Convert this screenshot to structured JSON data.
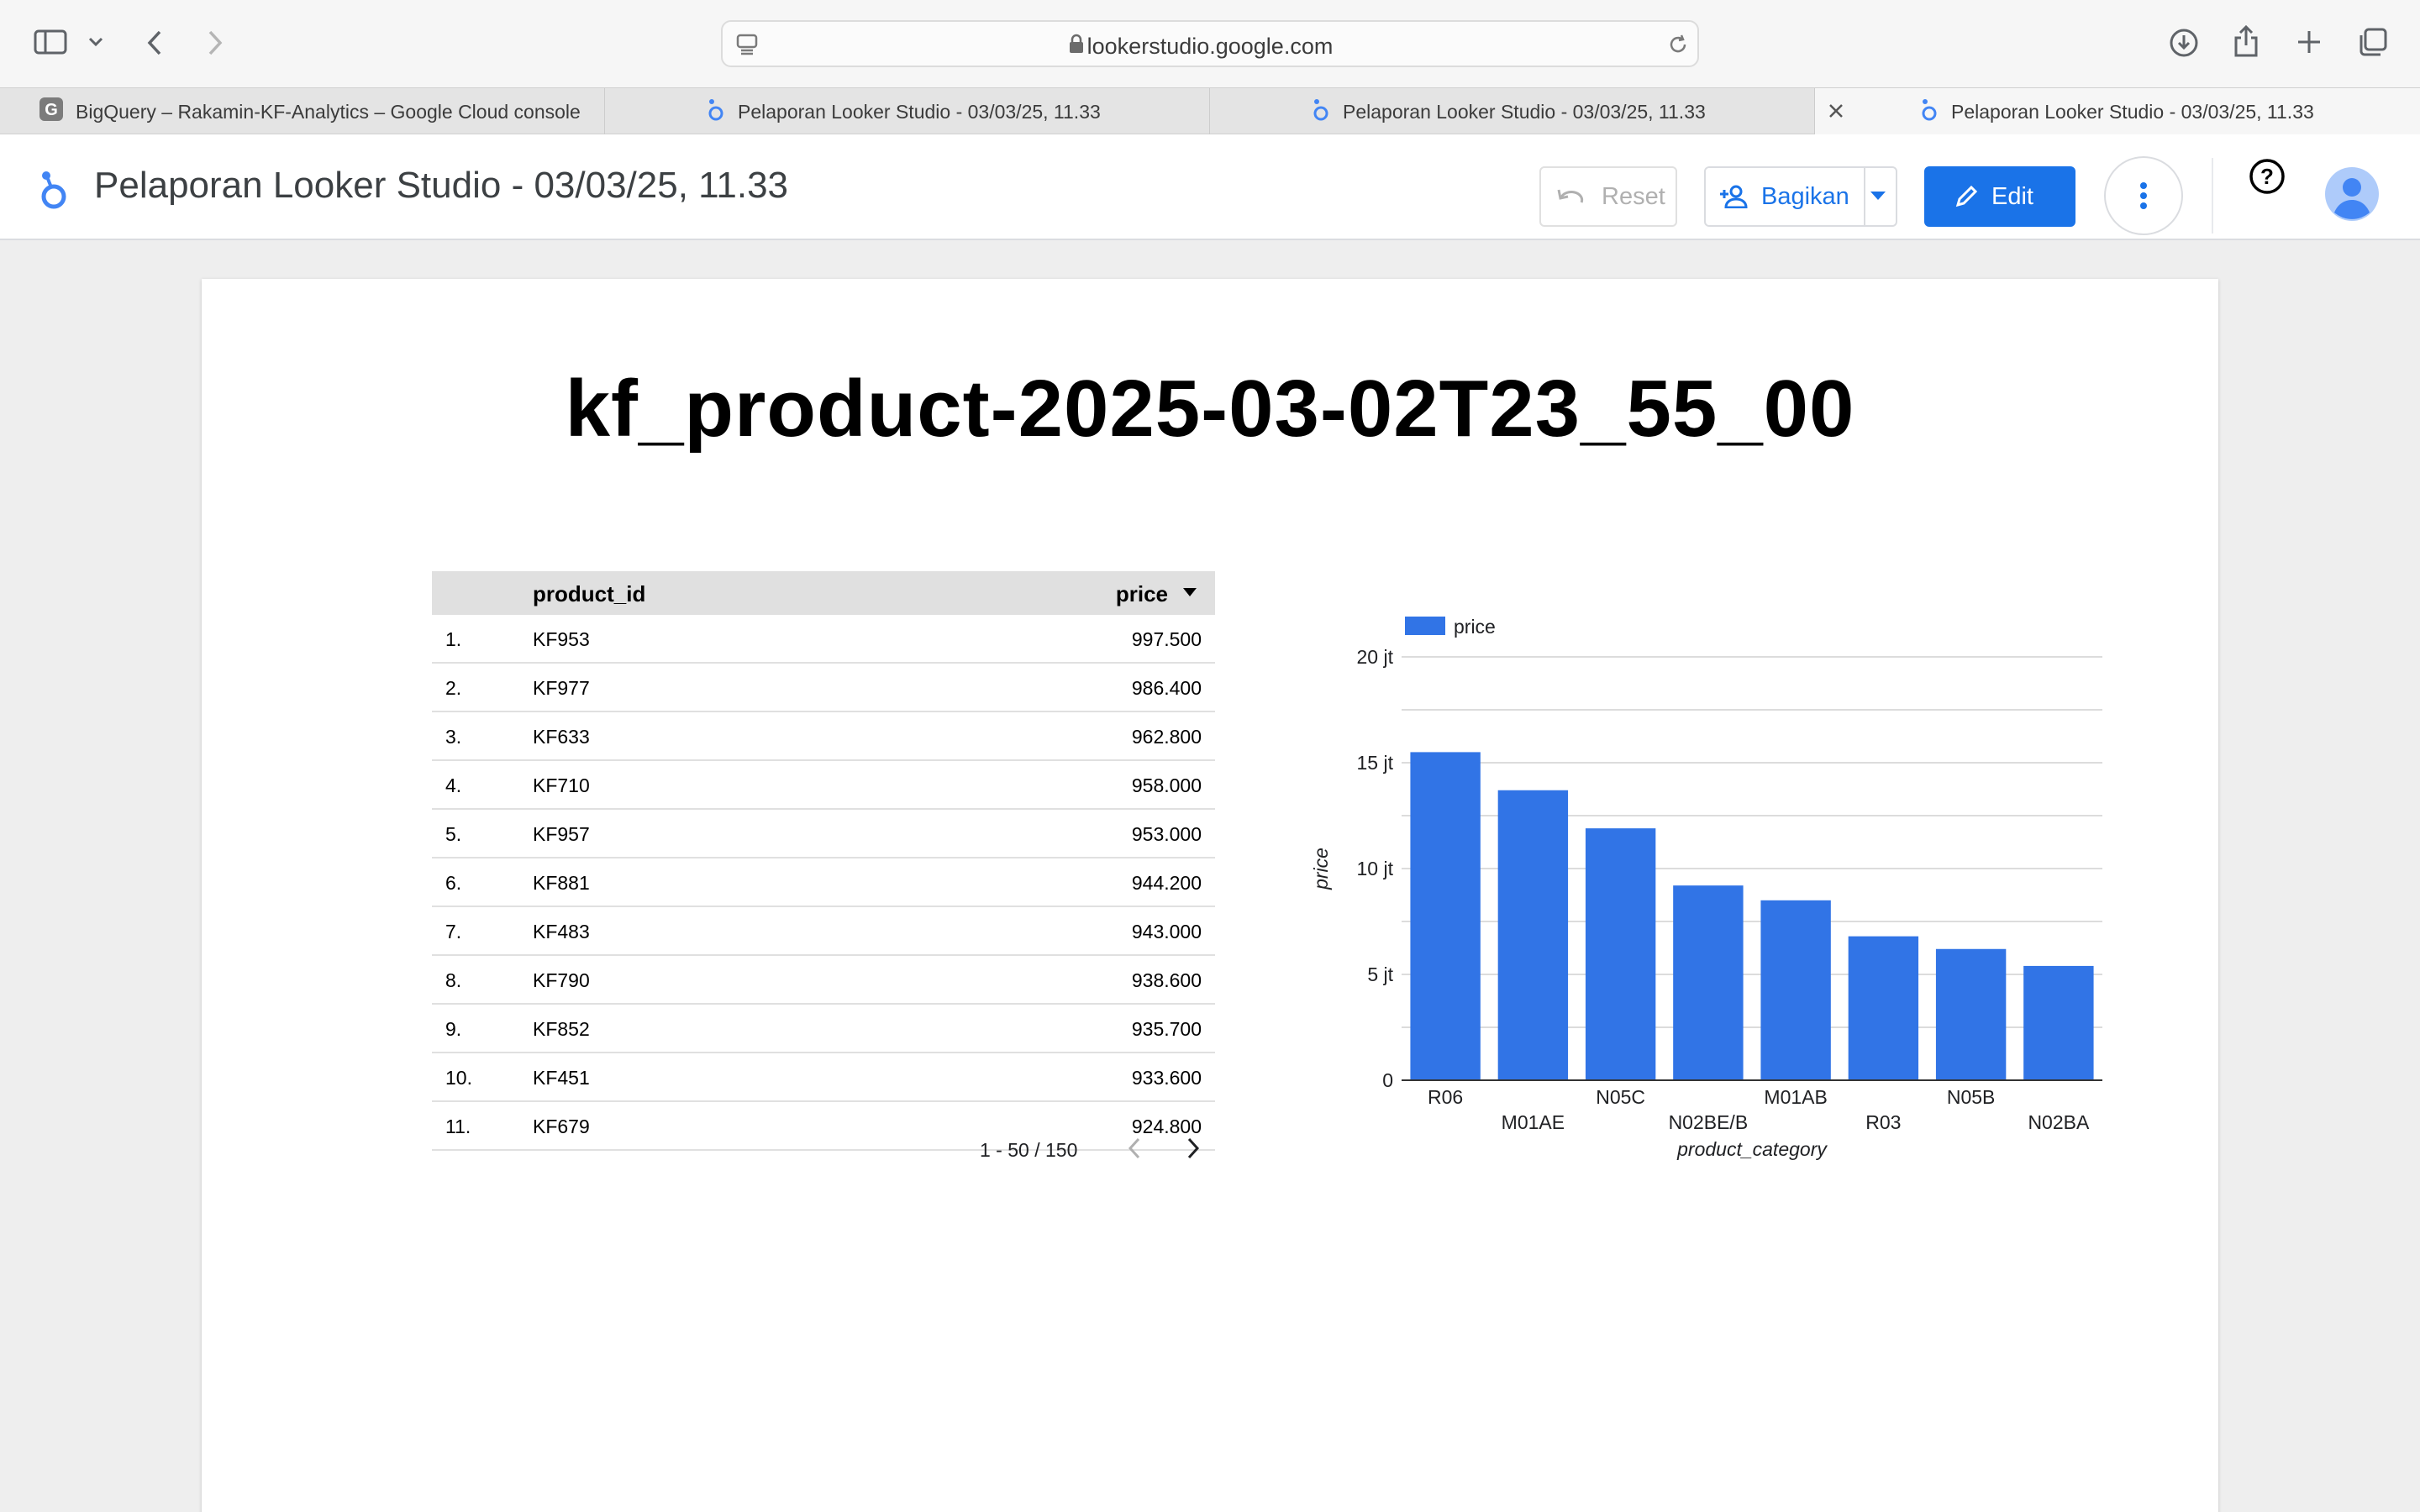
{
  "browser": {
    "url": "lookerstudio.google.com",
    "tabs": [
      {
        "title": "BigQuery – Rakamin-KF-Analytics – Google Cloud console",
        "favicon": "google-g-icon",
        "active": false
      },
      {
        "title": "Pelaporan Looker Studio - 03/03/25, 11.33",
        "favicon": "looker-studio-icon",
        "active": false
      },
      {
        "title": "Pelaporan Looker Studio - 03/03/25, 11.33",
        "favicon": "looker-studio-icon",
        "active": false
      },
      {
        "title": "Pelaporan Looker Studio - 03/03/25, 11.33",
        "favicon": "looker-studio-icon",
        "active": true
      }
    ]
  },
  "header": {
    "title": "Pelaporan Looker Studio - 03/03/25, 11.33",
    "reset_label": "Reset",
    "share_label": "Bagikan",
    "edit_label": "Edit",
    "help_symbol": "?"
  },
  "report": {
    "title": "kf_product-2025-03-02T23_55_00"
  },
  "table": {
    "columns": [
      "product_id",
      "price"
    ],
    "rows": [
      {
        "rank": "1.",
        "product_id": "KF953",
        "price": "997.500"
      },
      {
        "rank": "2.",
        "product_id": "KF977",
        "price": "986.400"
      },
      {
        "rank": "3.",
        "product_id": "KF633",
        "price": "962.800"
      },
      {
        "rank": "4.",
        "product_id": "KF710",
        "price": "958.000"
      },
      {
        "rank": "5.",
        "product_id": "KF957",
        "price": "953.000"
      },
      {
        "rank": "6.",
        "product_id": "KF881",
        "price": "944.200"
      },
      {
        "rank": "7.",
        "product_id": "KF483",
        "price": "943.000"
      },
      {
        "rank": "8.",
        "product_id": "KF790",
        "price": "938.600"
      },
      {
        "rank": "9.",
        "product_id": "KF852",
        "price": "935.700"
      },
      {
        "rank": "10.",
        "product_id": "KF451",
        "price": "933.600"
      },
      {
        "rank": "11.",
        "product_id": "KF679",
        "price": "924.800"
      }
    ],
    "pagination": "1 - 50 / 150"
  },
  "chart_data": {
    "type": "bar",
    "legend": "price",
    "legend_position": "top-left",
    "xlabel": "product_category",
    "ylabel": "price",
    "categories": [
      "R06",
      "M01AE",
      "N05C",
      "N02BE/B",
      "M01AB",
      "R03",
      "N05B",
      "N02BA"
    ],
    "values": [
      15500000,
      13700000,
      11900000,
      9200000,
      8500000,
      6800000,
      6200000,
      5400000
    ],
    "ylim": [
      0,
      20000000
    ],
    "yticks": [
      0,
      5000000,
      10000000,
      15000000,
      20000000
    ],
    "ytick_labels": [
      "0",
      "5 jt",
      "10 jt",
      "15 jt",
      "20 jt"
    ],
    "grid": true,
    "color": "#3174e6"
  },
  "colors": {
    "accent": "#1a73e8",
    "bar": "#3174e6"
  }
}
